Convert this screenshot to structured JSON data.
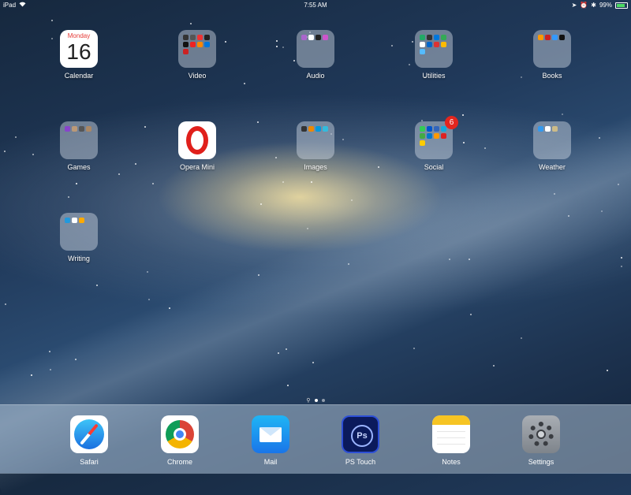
{
  "status_bar": {
    "device": "iPad",
    "time": "7:55 AM",
    "battery": "99%"
  },
  "home": {
    "calendar": {
      "label": "Calendar",
      "day_name": "Monday",
      "day_number": "16"
    },
    "folders": [
      {
        "label": "Video"
      },
      {
        "label": "Audio"
      },
      {
        "label": "Utilities"
      },
      {
        "label": "Books"
      },
      {
        "label": "Games"
      },
      {
        "label": "Images"
      },
      {
        "label": "Social",
        "badge": "6"
      },
      {
        "label": "Weather"
      },
      {
        "label": "Writing"
      }
    ],
    "opera": {
      "label": "Opera Mini"
    }
  },
  "dock": [
    {
      "label": "Safari",
      "icon": "safari-icon"
    },
    {
      "label": "Chrome",
      "icon": "chrome-icon"
    },
    {
      "label": "Mail",
      "icon": "mail-icon"
    },
    {
      "label": "PS Touch",
      "icon": "ps-touch-icon",
      "glyph": "Ps"
    },
    {
      "label": "Notes",
      "icon": "notes-icon"
    },
    {
      "label": "Settings",
      "icon": "settings-icon"
    }
  ],
  "page_dots": {
    "count": 2,
    "active": 1
  }
}
